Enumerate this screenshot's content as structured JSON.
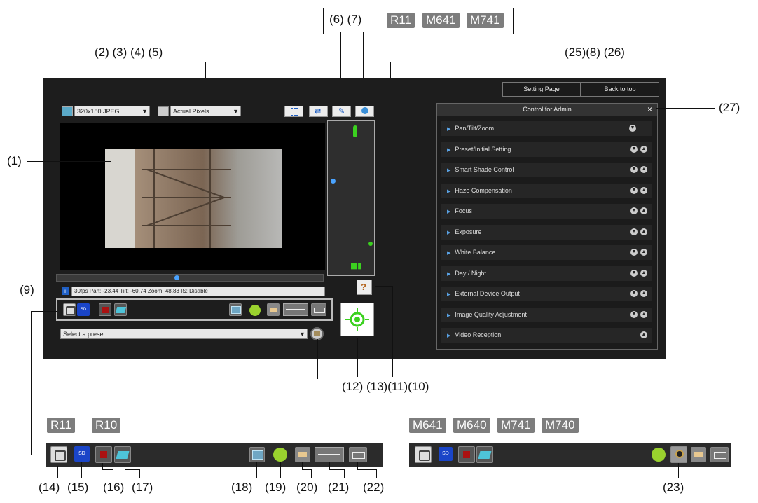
{
  "top_badges": [
    "R11",
    "M641",
    "M741"
  ],
  "callouts": {
    "c6_7": "(6) (7)",
    "c2_5": "(2) (3) (4) (5)",
    "c25_26": "(25)(8) (26)",
    "c27": "(27)",
    "c1": "(1)",
    "c9": "(9)",
    "c12_10": "(12) (13)(11)(10)",
    "c14": "(14)",
    "c15": "(15)",
    "c16": "(16)",
    "c17": "(17)",
    "c18": "(18)",
    "c19": "(19)",
    "c20": "(20)",
    "c21": "(21)",
    "c22": "(22)",
    "c23": "(23)"
  },
  "viewer": {
    "video_size": "320x180 JPEG",
    "view_size": "Actual Pixels",
    "status_text": "30fps Pan: -23.44 Tilt: -60.74 Zoom: 48.83 IS: Disable",
    "preset_placeholder": "Select a preset.",
    "setting_page": "Setting Page",
    "back_to_top": "Back to top",
    "panel_title": "Control for Admin",
    "panel_close": "×",
    "panel_items": [
      "Pan/Tilt/Zoom",
      "Preset/Initial Setting",
      "Smart Shade Control",
      "Haze Compensation",
      "Focus",
      "Exposure",
      "White Balance",
      "Day / Night",
      "External Device Output",
      "Image Quality Adjustment",
      "Video Reception"
    ],
    "sd_label": "SD"
  },
  "bottom_left_badges": [
    "R11",
    "R10"
  ],
  "bottom_right_badges": [
    "M641",
    "M640",
    "M741",
    "M740"
  ],
  "colors": {
    "dark_bg": "#1d1d1d",
    "panel_bg": "#262626",
    "badge_bg": "#7d7d7d",
    "accent_blue": "#1f5fc4",
    "accent_green": "#3bd11f"
  }
}
